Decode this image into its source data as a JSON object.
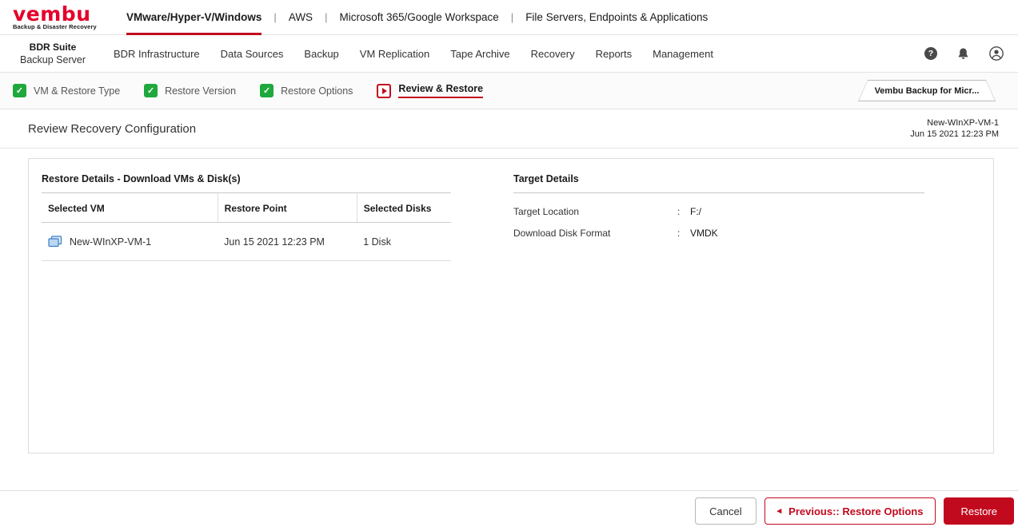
{
  "brand": {
    "logo_text": "vembu",
    "tagline": "Backup & Disaster Recovery",
    "suite": "BDR Suite",
    "server": "Backup Server"
  },
  "top_nav": {
    "separator": "|",
    "items": [
      {
        "label": "VMware/Hyper-V/Windows",
        "active": true
      },
      {
        "label": "AWS",
        "active": false
      },
      {
        "label": "Microsoft 365/Google Workspace",
        "active": false
      },
      {
        "label": "File Servers, Endpoints & Applications",
        "active": false
      }
    ]
  },
  "main_nav": {
    "items": [
      {
        "label": "BDR Infrastructure"
      },
      {
        "label": "Data Sources"
      },
      {
        "label": "Backup"
      },
      {
        "label": "VM Replication"
      },
      {
        "label": "Tape Archive"
      },
      {
        "label": "Recovery"
      },
      {
        "label": "Reports"
      },
      {
        "label": "Management"
      }
    ]
  },
  "wizard": {
    "steps": [
      {
        "label": "VM & Restore Type",
        "state": "done"
      },
      {
        "label": "Restore Version",
        "state": "done"
      },
      {
        "label": "Restore Options",
        "state": "done"
      },
      {
        "label": "Review & Restore",
        "state": "active"
      }
    ],
    "context_tab": "Vembu Backup for Micr..."
  },
  "page": {
    "title": "Review Recovery Configuration",
    "meta_vm": "New-WInXP-VM-1",
    "meta_time": "Jun 15 2021 12:23 PM"
  },
  "restore_details": {
    "title": "Restore Details - Download VMs & Disk(s)",
    "columns": [
      "Selected VM",
      "Restore Point",
      "Selected Disks"
    ],
    "rows": [
      {
        "vm": "New-WInXP-VM-1",
        "restore_point": "Jun 15 2021 12:23 PM",
        "disks": "1 Disk"
      }
    ]
  },
  "target_details": {
    "title": "Target Details",
    "colon": ":",
    "rows": [
      {
        "label": "Target Location",
        "value": "F:/"
      },
      {
        "label": "Download Disk Format",
        "value": "VMDK"
      }
    ]
  },
  "footer": {
    "cancel": "Cancel",
    "previous": "Previous:: Restore Options",
    "restore": "Restore"
  },
  "icons": {
    "check": "✓",
    "help": "?",
    "previous_arrow": "◂"
  },
  "colors": {
    "brand_red": "#e4002b",
    "accent_red": "#c20a1e",
    "success_green": "#1fa83c"
  }
}
